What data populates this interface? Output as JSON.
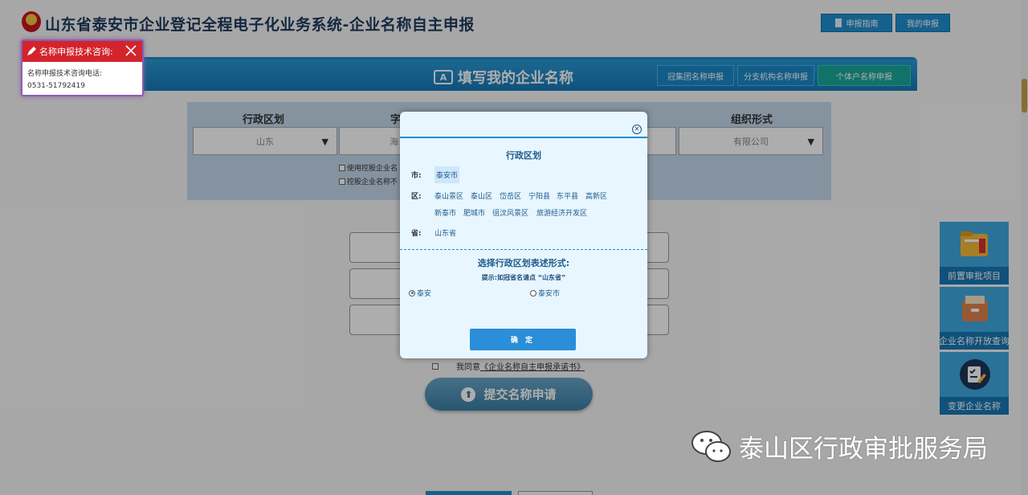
{
  "header": {
    "title": "山东省泰安市企业登记全程电子化业务系统-企业名称自主申报",
    "guide_label": "申报指南",
    "my_apply_label": "我的申报"
  },
  "banner": {
    "title": "填写我的企业名称",
    "group_label": "冠集团名称申报",
    "branch_label": "分支机构名称申报",
    "individual_label": "个体户名称申报"
  },
  "form": {
    "region_label": "行政区划",
    "region_value": "山东",
    "zihao_label": "字",
    "zihao_value": "海",
    "org_label": "组织形式",
    "org_value": "有限公司",
    "check1": "使用控股企业名",
    "check2": "控股企业名称不",
    "agree_prefix": "我同意",
    "agree_link": "《企业名称自主申报承诺书》",
    "submit_label": "提交名称申请"
  },
  "side": {
    "item1": "前置审批项目",
    "item2": "企业名称开放查询",
    "item3": "变更企业名称"
  },
  "consult": {
    "title": "名称申报技术咨询:",
    "line1": "名称申报技术咨询电话:",
    "line2": "0531-51792419"
  },
  "modal": {
    "title": "行政区划",
    "city_label": "市:",
    "city": "泰安市",
    "district_label": "区:",
    "districts": [
      "泰山景区",
      "泰山区",
      "岱岳区",
      "宁阳县",
      "东平县",
      "高新区",
      "新泰市",
      "肥城市",
      "徂汶风景区",
      "旅游经济开发区"
    ],
    "prov_label": "省:",
    "prov": "山东省",
    "form_title": "选择行政区划表述形式:",
    "hint": "提示:如冠省名请点 “山东省”",
    "radio1": "泰安",
    "radio2": "泰安市",
    "confirm": "确 定"
  },
  "watermark": "泰山区行政审批服务局",
  "colors": {
    "accent": "#1f8fd0",
    "danger": "#d3242c"
  }
}
